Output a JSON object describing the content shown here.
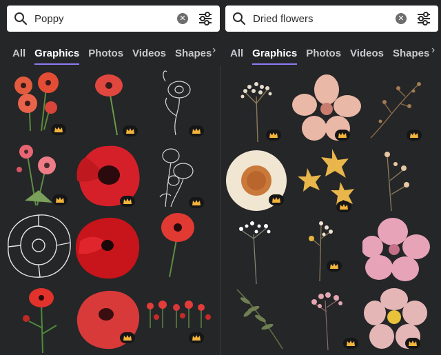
{
  "left": {
    "search": {
      "query": "Poppy"
    },
    "tabs": [
      "All",
      "Graphics",
      "Photos",
      "Videos",
      "Shapes"
    ],
    "active_tab": "Graphics",
    "results": [
      "red-poppy-bunch",
      "single-red-poppy",
      "line-art-poppy",
      "pink-poppy-bouquet",
      "large-red-poppy",
      "line-art-poppy-stems",
      "outline-poppy-flower",
      "red-poppy-photo",
      "poppy-on-stem",
      "watercolor-poppy-stem",
      "watercolor-poppy-head",
      "poppy-field-border"
    ]
  },
  "right": {
    "search": {
      "query": "Dried flowers"
    },
    "tabs": [
      "All",
      "Graphics",
      "Photos",
      "Videos",
      "Shapes"
    ],
    "active_tab": "Graphics",
    "results": [
      "dried-white-sprig",
      "pressed-pink-flower",
      "dried-brown-sprig",
      "pressed-daisy",
      "pressed-yellow-flowers",
      "dried-flower-stem",
      "dried-white-gypsophila",
      "dried-mixed-sprig",
      "pressed-pink-flower-2",
      "dried-green-fern",
      "dried-pink-sprig",
      "pressed-cosmos"
    ]
  },
  "icons": {
    "search": "search-icon",
    "clear": "clear-search-icon",
    "filter": "filter-sliders-icon",
    "premium": "crown-icon",
    "scroll": "chevron-right-icon"
  },
  "colors": {
    "accent": "#8b7cf6",
    "background": "#252628",
    "crown": "#f3b43c"
  }
}
